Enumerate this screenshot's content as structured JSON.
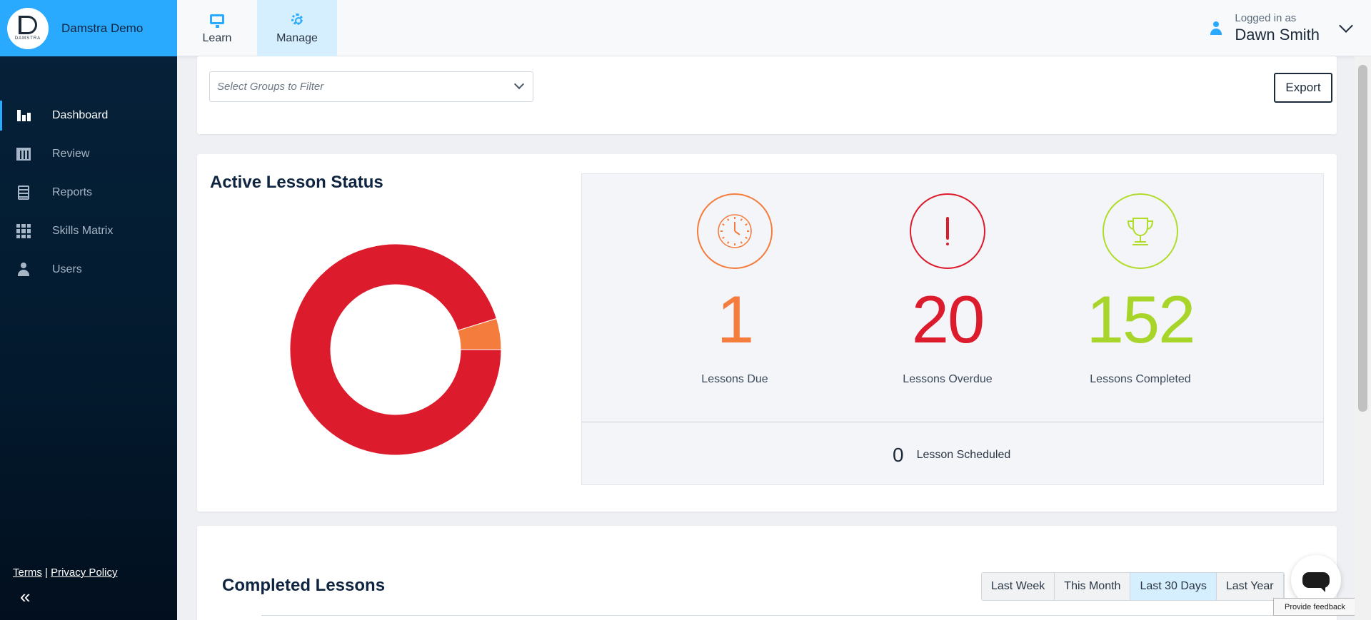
{
  "brand": {
    "name": "Damstra Demo",
    "logo_text": "DAMSTRA"
  },
  "sidebar": {
    "items": [
      {
        "label": "Dashboard",
        "icon": "bar-chart-icon",
        "active": true
      },
      {
        "label": "Review",
        "icon": "calendar-icon"
      },
      {
        "label": "Reports",
        "icon": "clipboard-icon"
      },
      {
        "label": "Skills Matrix",
        "icon": "grid-icon"
      },
      {
        "label": "Users",
        "icon": "user-icon"
      }
    ],
    "footer": {
      "terms": "Terms",
      "separator": "|",
      "privacy": "Privacy Policy",
      "collapse": "«"
    }
  },
  "topbar": {
    "tabs": [
      {
        "label": "Learn",
        "icon": "monitor-icon"
      },
      {
        "label": "Manage",
        "icon": "gear-icon",
        "active": true
      }
    ],
    "user": {
      "logged_in_label": "Logged in as",
      "name": "Dawn Smith"
    }
  },
  "filter": {
    "placeholder": "Select Groups to Filter",
    "export_label": "Export"
  },
  "status": {
    "title": "Active Lesson Status",
    "due": {
      "value": "1",
      "label": "Lessons Due",
      "color": "#f47c3c"
    },
    "overdue": {
      "value": "20",
      "label": "Lessons Overdue",
      "color": "#dc1b2c"
    },
    "completed": {
      "value": "152",
      "label": "Lessons Completed",
      "color": "#a8d52a"
    },
    "scheduled": {
      "value": "0",
      "label": "Lesson Scheduled"
    }
  },
  "chart_data": {
    "type": "pie",
    "categories": [
      "Lessons Due",
      "Lessons Overdue"
    ],
    "values": [
      1,
      20
    ],
    "colors": [
      "#f47c3c",
      "#dc1b2c"
    ]
  },
  "completed_section": {
    "title": "Completed Lessons",
    "ranges": [
      {
        "label": "Last Week"
      },
      {
        "label": "This Month"
      },
      {
        "label": "Last 30 Days",
        "active": true
      },
      {
        "label": "Last Year"
      }
    ]
  },
  "feedback": {
    "label": "Provide feedback"
  }
}
